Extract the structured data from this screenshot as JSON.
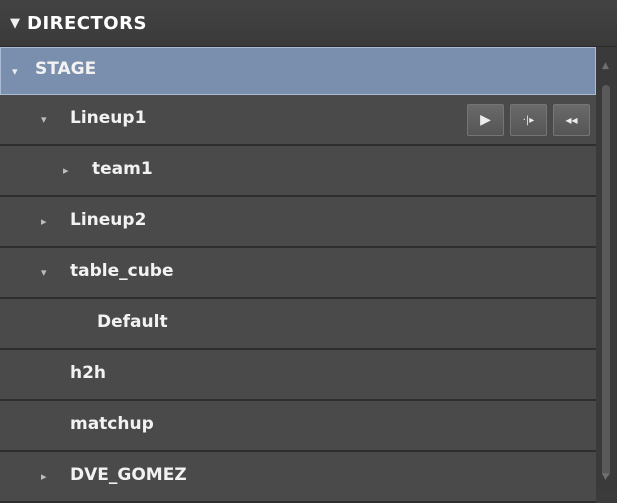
{
  "header": {
    "title": "DIRECTORS",
    "arrow": "▼"
  },
  "rows": [
    {
      "label": "STAGE",
      "arrow": "▾"
    },
    {
      "label": "Lineup1",
      "arrow": "▾"
    },
    {
      "label": "team1",
      "arrow": "▸"
    },
    {
      "label": "Lineup2",
      "arrow": "▸"
    },
    {
      "label": "table_cube",
      "arrow": "▾"
    },
    {
      "label": "Default"
    },
    {
      "label": "h2h"
    },
    {
      "label": "matchup"
    },
    {
      "label": "DVE_GOMEZ",
      "arrow": "▸"
    }
  ],
  "controls": {
    "play": "▶",
    "step": "·|▸",
    "rewind": "◂◂"
  },
  "scrollbar": {
    "up": "▲",
    "down": "▼"
  }
}
